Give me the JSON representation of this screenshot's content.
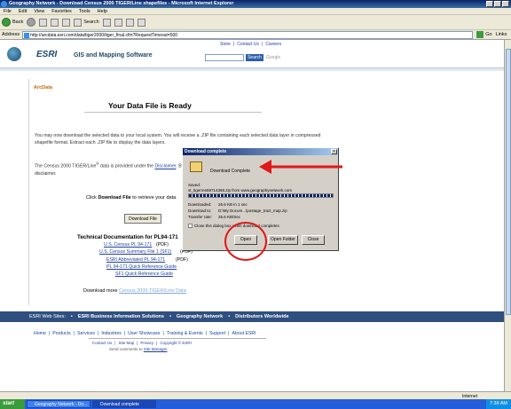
{
  "window": {
    "title": "Geography Network - Download Census 2000 TIGER/Line shapefiles - Microsoft Internet Explorer"
  },
  "menu": [
    "File",
    "Edit",
    "View",
    "Favorites",
    "Tools",
    "Help"
  ],
  "toolbar": {
    "back": "Back",
    "search": "Search"
  },
  "address": {
    "label": "Address",
    "url": "http://arcdata.esri.com/data/tiger2000/tiger_final.cfm?RequestTimeout=500",
    "go": "Go",
    "links": "Links"
  },
  "header": {
    "toplinks": [
      "Store",
      "Contact Us",
      "Careers"
    ],
    "logo": "ESRI",
    "tagline": "GIS and Mapping Software",
    "search_button": "Search",
    "google": "Google"
  },
  "page": {
    "section": "ArcData",
    "title": "Your Data File is Ready",
    "para1": "You may now download the selected data to your local system. You will receive a .ZIP file containing each selected data layer in compressed shapefile format. Extract each .ZIP file to display the data layers.",
    "para2_a": "The Census 2000 TIGER/Line",
    "para2_b": " data is provided under the ",
    "para2_link": "Disclaimer",
    "para2_c": ". By downloading the data, you are indicating your acceptance of the disclaimer.",
    "click_prefix": "Click ",
    "click_bold": "Download File",
    "click_suffix": " to retrieve your data.",
    "download_button": "Download File",
    "tech_title": "Technical Documentation for PL94-171",
    "tech_links": [
      {
        "link": "U.S. Census PL 94-171",
        "suffix": "(PDF)"
      },
      {
        "link": "U.S. Census Summary File 1 (SF1)",
        "suffix": "(PDF)"
      },
      {
        "link": "ESRI Abbreviated PL 94-171",
        "suffix": "(PDF)"
      },
      {
        "link": "PL 94-171 Quick Reference Guide",
        "suffix": ""
      },
      {
        "link": "SF1 Quick Reference Guide",
        "suffix": ""
      }
    ],
    "download_more_prefix": "Download more ",
    "download_more_link": "Census 2000 TIGER/Line Data"
  },
  "sites_bar": {
    "label": "ESRI Web Sites:",
    "items": [
      "ESRI Business Information Solutions",
      "Geography Network",
      "Distributors Worldwide"
    ]
  },
  "footer": {
    "links": [
      "Home",
      "Products",
      "Services",
      "Industries",
      "User Showcase",
      "Training & Events",
      "Support",
      "About ESRI"
    ],
    "small_links": [
      "Contact Us",
      "Site Map",
      "Privacy",
      "Copyright © ESRI"
    ],
    "send_comments_prefix": "Send comments to ",
    "send_comments_link": "Site Manager"
  },
  "dialog": {
    "title": "Download complete",
    "heading": "Download Complete",
    "saved_label": "Saved:",
    "file": "st_tigerres69714368.zip from www.geographynetwork.com",
    "rows": [
      {
        "k": "Downloaded:",
        "v": "26.6 KB in 1 sec"
      },
      {
        "k": "Download to:",
        "v": "D:\\My Docum...\\postage_tract_map.zip"
      },
      {
        "k": "Transfer rate:",
        "v": "26.6 KB/Sec"
      }
    ],
    "checkbox": "Close this dialog box when download completes",
    "buttons": [
      "Open",
      "Open Folder",
      "Close"
    ]
  },
  "statusbar": {
    "zone": "Internet"
  },
  "taskbar": {
    "start": "start",
    "tasks": [
      "Geography Network - Do...",
      "Download complete"
    ],
    "clock": "7:38 AM"
  },
  "colors": {
    "annotation": "#e01818",
    "title_bar": "#0a246a",
    "site_bar": "#2f4f80"
  }
}
